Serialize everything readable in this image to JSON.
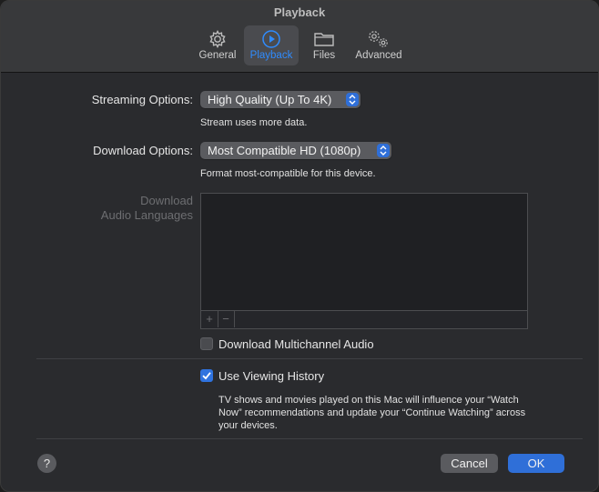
{
  "window": {
    "title": "Playback"
  },
  "tabs": [
    {
      "label": "General",
      "icon": "gear-icon"
    },
    {
      "label": "Playback",
      "icon": "play-circle-icon",
      "active": true
    },
    {
      "label": "Files",
      "icon": "folder-icon"
    },
    {
      "label": "Advanced",
      "icon": "gears-icon"
    }
  ],
  "streaming": {
    "label": "Streaming Options:",
    "value": "High Quality (Up To 4K)",
    "help": "Stream uses more data."
  },
  "download": {
    "label": "Download Options:",
    "value": "Most Compatible HD (1080p)",
    "help": "Format most-compatible for this device."
  },
  "audio_languages": {
    "label_line1": "Download",
    "label_line2": "Audio Languages",
    "add_label": "+",
    "remove_label": "−"
  },
  "multichannel": {
    "label": "Download Multichannel Audio",
    "checked": false
  },
  "history": {
    "label": "Use Viewing History",
    "checked": true,
    "help_line1": "TV shows and movies played on this Mac will influence your “Watch",
    "help_line2": "Now” recommendations and update your “Continue Watching” across",
    "help_line3": "your devices."
  },
  "buttons": {
    "help": "?",
    "cancel": "Cancel",
    "ok": "OK"
  },
  "colors": {
    "accent": "#2f8cff",
    "button_blue": "#2f6fd8"
  }
}
